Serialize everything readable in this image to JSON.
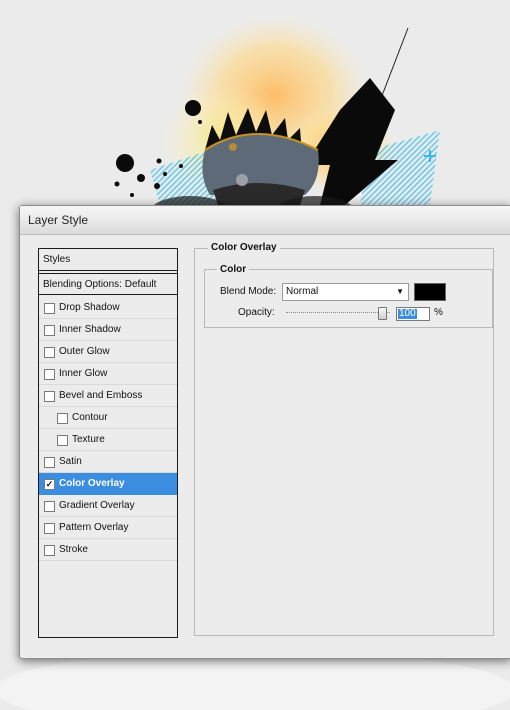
{
  "dialog": {
    "title": "Layer Style"
  },
  "sidebar": {
    "styles_header": "Styles",
    "blending_header": "Blending Options: Default",
    "items": [
      {
        "label": "Drop Shadow",
        "checked": false,
        "indent": false,
        "selected": false
      },
      {
        "label": "Inner Shadow",
        "checked": false,
        "indent": false,
        "selected": false
      },
      {
        "label": "Outer Glow",
        "checked": false,
        "indent": false,
        "selected": false
      },
      {
        "label": "Inner Glow",
        "checked": false,
        "indent": false,
        "selected": false
      },
      {
        "label": "Bevel and Emboss",
        "checked": false,
        "indent": false,
        "selected": false
      },
      {
        "label": "Contour",
        "checked": false,
        "indent": true,
        "selected": false
      },
      {
        "label": "Texture",
        "checked": false,
        "indent": true,
        "selected": false
      },
      {
        "label": "Satin",
        "checked": false,
        "indent": false,
        "selected": false
      },
      {
        "label": "Color Overlay",
        "checked": true,
        "indent": false,
        "selected": true
      },
      {
        "label": "Gradient Overlay",
        "checked": false,
        "indent": false,
        "selected": false
      },
      {
        "label": "Pattern Overlay",
        "checked": false,
        "indent": false,
        "selected": false
      },
      {
        "label": "Stroke",
        "checked": false,
        "indent": false,
        "selected": false
      }
    ]
  },
  "panel": {
    "section_title": "Color Overlay",
    "group_title": "Color",
    "blend_mode_label": "Blend Mode:",
    "blend_mode_value": "Normal",
    "overlay_color": "#000000",
    "opacity_label": "Opacity:",
    "opacity_value": "100",
    "opacity_unit": "%"
  },
  "colors": {
    "selection": "#3b8de0",
    "dialog_bg": "#ececec"
  }
}
